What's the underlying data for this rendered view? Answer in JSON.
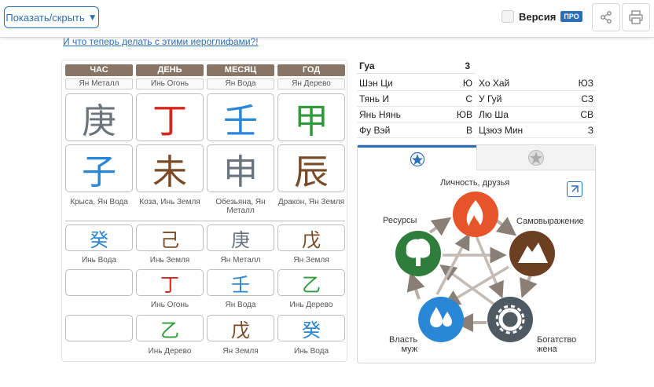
{
  "toolbar": {
    "toggle_label": "Показать/скрыть",
    "version_label": "Версия",
    "pro_badge": "ПРО"
  },
  "link_text": "И что теперь делать с этими иероглифами?!",
  "pillars": {
    "headers": [
      "ЧАС",
      "ДЕНЬ",
      "МЕСЯЦ",
      "ГОД"
    ],
    "stem_elements": [
      "Ян Металл",
      "Инь Огонь",
      "Ян Вода",
      "Ян Дерево"
    ],
    "stems": [
      "庚",
      "丁",
      "壬",
      "甲"
    ],
    "branches": [
      "子",
      "未",
      "申",
      "辰"
    ],
    "branch_labels": [
      "Крыса, Ян Вода",
      "Коза, Инь Земля",
      "Обезьяна, Ян Металл",
      "Дракон, Ян Земля"
    ],
    "hidden": [
      {
        "chars": [
          "癸",
          "己",
          "庚",
          "戊"
        ],
        "labels": [
          "Инь Вода",
          "Инь Земля",
          "Ян Металл",
          "Ян Земля"
        ]
      },
      {
        "chars": [
          "",
          "丁",
          "壬",
          "乙"
        ],
        "labels": [
          "",
          "Инь Огонь",
          "Ян Вода",
          "Инь Дерево"
        ]
      },
      {
        "chars": [
          "",
          "乙",
          "戊",
          "癸"
        ],
        "labels": [
          "",
          "Инь Дерево",
          "Ян Земля",
          "Инь Вода"
        ]
      }
    ]
  },
  "gua": {
    "label": "Гуа",
    "value": "3",
    "left": [
      {
        "name": "Шэн Ци",
        "dir": "Ю"
      },
      {
        "name": "Тянь И",
        "dir": "С"
      },
      {
        "name": "Янь Нянь",
        "dir": "ЮВ"
      },
      {
        "name": "Фу Вэй",
        "dir": "В"
      }
    ],
    "right": [
      {
        "name": "Хо Хай",
        "dir": "ЮЗ"
      },
      {
        "name": "У Гуй",
        "dir": "СЗ"
      },
      {
        "name": "Лю Ша",
        "dir": "СВ"
      },
      {
        "name": "Цзюэ Мин",
        "dir": "З"
      }
    ]
  },
  "elements": {
    "labels": {
      "fire": "Личность, друзья",
      "earth": "Самовыражение",
      "wood": "Ресурсы",
      "metal_line1": "Богатство",
      "metal_line2": "жена",
      "water_line1": "Власть",
      "water_line2": "муж"
    }
  },
  "colors": {
    "accent": "#2d6fb7",
    "header_brown": "#887566",
    "fire": "#d7261e",
    "water": "#2a86d6",
    "wood": "#2f9a3a",
    "earth": "#7a4a26",
    "metal": "#6b737c"
  }
}
